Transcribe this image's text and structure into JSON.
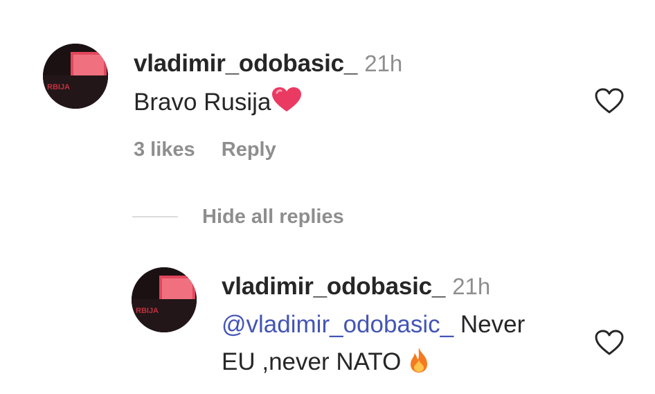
{
  "comment": {
    "username": "vladimir_odobasic_",
    "time": "21h",
    "text": "Bravo Rusija",
    "emoji": "heart-emoji",
    "likes": "3 likes",
    "reply_label": "Reply"
  },
  "replies_toggle": {
    "label": "Hide all replies"
  },
  "reply": {
    "username": "vladimir_odobasic_",
    "time": "21h",
    "mention": "@vladimir_odobasic_",
    "text_line1": " Never",
    "text_line2": "EU ,never NATO",
    "emoji": "fire-emoji"
  },
  "colors": {
    "text": "#262626",
    "muted": "#8e8e8e",
    "mention": "#4455b5",
    "heart_emoji": "#e8375f",
    "fire_emoji": "#f57a1f"
  }
}
